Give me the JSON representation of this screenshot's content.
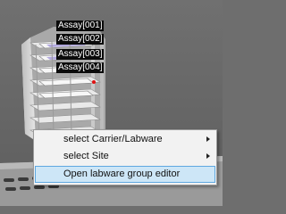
{
  "assay_labels": [
    "Assay[001]",
    "Assay[002]",
    "Assay[003]",
    "Assay[004]"
  ],
  "context_menu": {
    "items": [
      {
        "label": "select Carrier/Labware",
        "has_submenu": true
      },
      {
        "label": "select Site",
        "has_submenu": true
      },
      {
        "label": "Open labware group editor",
        "has_submenu": false,
        "selected": true
      }
    ]
  },
  "colors": {
    "background": "#6e6e6e",
    "menu_background": "#f2f2f2",
    "menu_highlight": "#cde6f7",
    "menu_highlight_border": "#5fa8e0",
    "label_background": "#0b0b0b",
    "marker_red": "#e01010"
  }
}
